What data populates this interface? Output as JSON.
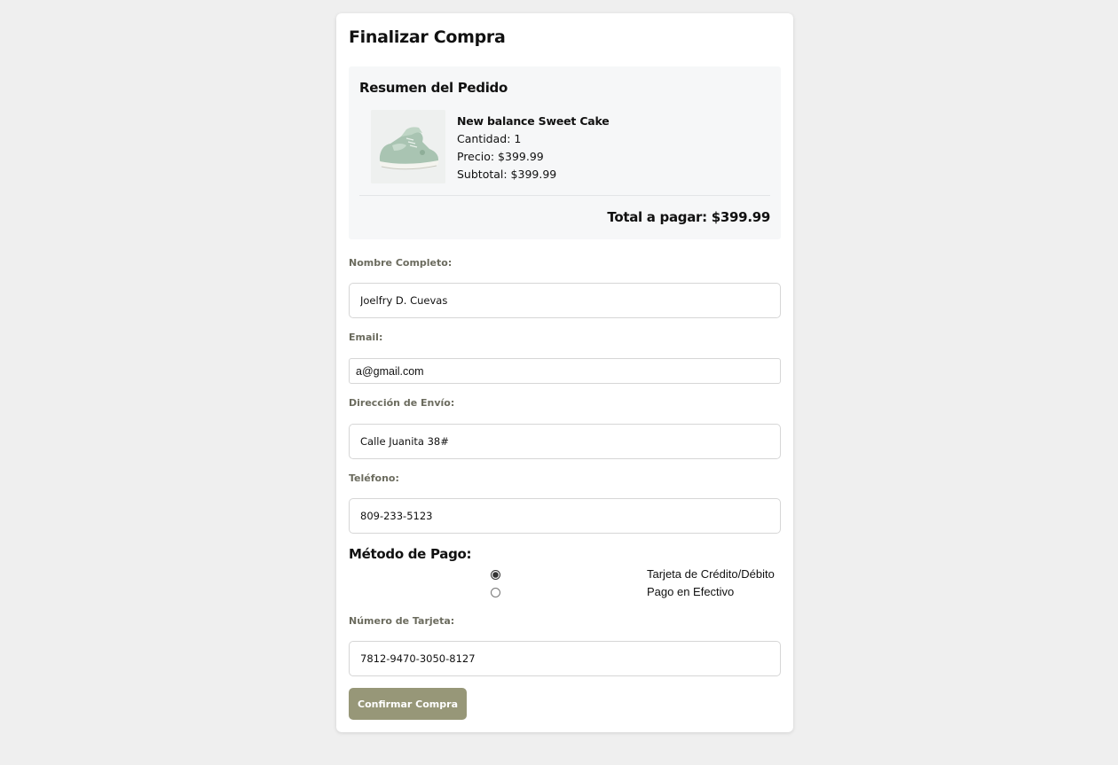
{
  "page": {
    "title": "Finalizar Compra"
  },
  "summary": {
    "title": "Resumen del Pedido",
    "product": {
      "name": "New balance Sweet Cake",
      "quantity": "Cantidad: 1",
      "price": "Precio: $399.99",
      "subtotal": "Subtotal: $399.99",
      "image_icon": "sneaker-image"
    },
    "total": "Total a pagar: $399.99"
  },
  "form": {
    "name_label": "Nombre Completo:",
    "name_value": "Joelfry D. Cuevas",
    "email_label": "Email:",
    "email_value": "a@gmail.com",
    "address_label": "Dirección de Envío:",
    "address_value": "Calle Juanita 38#",
    "phone_label": "Teléfono:",
    "phone_value": "809-233-5123"
  },
  "payment": {
    "title": "Método de Pago:",
    "options": [
      {
        "label": "Tarjeta de Crédito/Débito",
        "selected": true
      },
      {
        "label": "Pago en Efectivo",
        "selected": false
      }
    ],
    "card_label": "Número de Tarjeta:",
    "card_value": "7812-9470-3050-8127"
  },
  "actions": {
    "confirm_label": "Confirmar Compra"
  },
  "colors": {
    "accent": "#979778",
    "label": "#6b6b5e",
    "background": "#efefef"
  }
}
